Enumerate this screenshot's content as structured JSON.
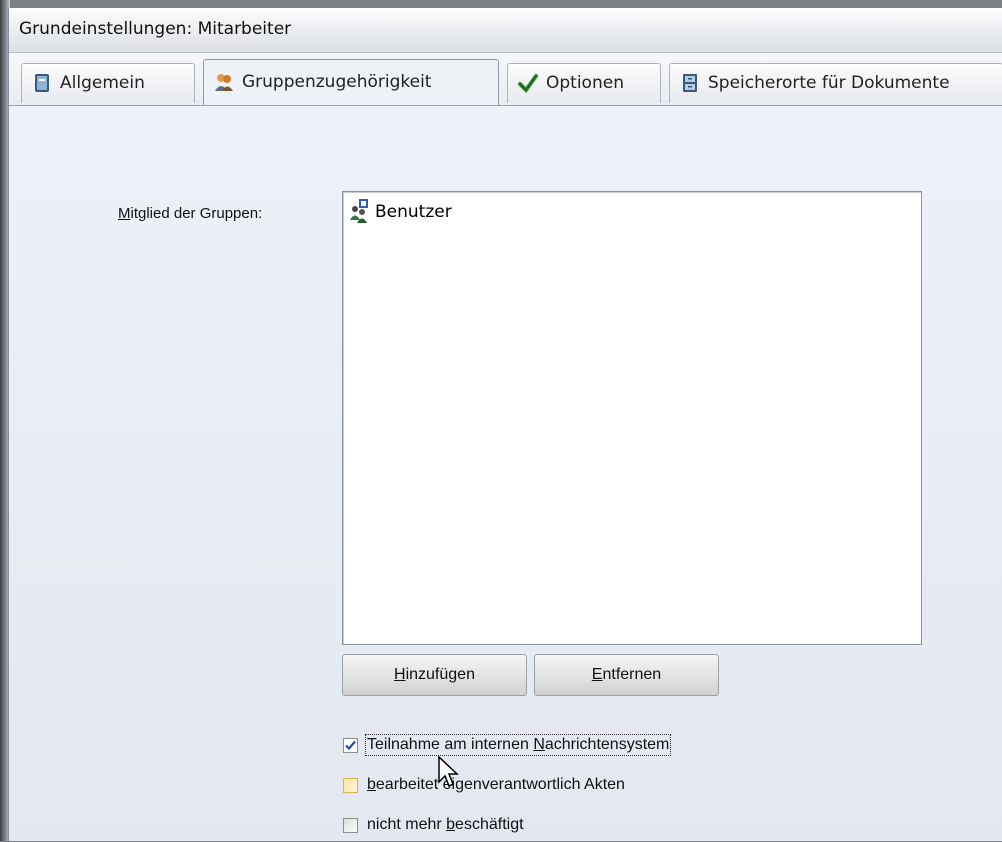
{
  "window": {
    "title": "Grundeinstellungen: Mitarbeiter"
  },
  "tabs": [
    {
      "label": "Allgemein",
      "icon": "book-icon",
      "active": false
    },
    {
      "label": "Gruppenzugehörigkeit",
      "icon": "users-group-icon",
      "active": true
    },
    {
      "label": "Optionen",
      "icon": "checkmark-icon",
      "active": false
    },
    {
      "label": "Speicherorte für Dokumente",
      "icon": "file-cabinet-icon",
      "active": false
    }
  ],
  "groups": {
    "label_first": "M",
    "label_rest": "itglied der Gruppen:",
    "items": [
      {
        "label": "Benutzer",
        "icon": "user-group-icon"
      }
    ]
  },
  "buttons": {
    "add_first": "H",
    "add_rest": "inzufügen",
    "remove_first": "E",
    "remove_rest": "ntfernen"
  },
  "options": {
    "messaging_pre": "Teilnahme am internen ",
    "messaging_u": "N",
    "messaging_post": "achrichtensystem",
    "messaging_checked": true,
    "self_responsible_u": "b",
    "self_responsible_post": "earbeitet eigenverantwortlich Akten",
    "self_responsible_checked": false,
    "not_employed_pre": "nicht mehr ",
    "not_employed_u": "b",
    "not_employed_post": "eschäftigt",
    "not_employed_checked": false
  },
  "colors": {
    "accent_check": "#1a4fb3",
    "hover_checkbox": "#fde5a8"
  }
}
